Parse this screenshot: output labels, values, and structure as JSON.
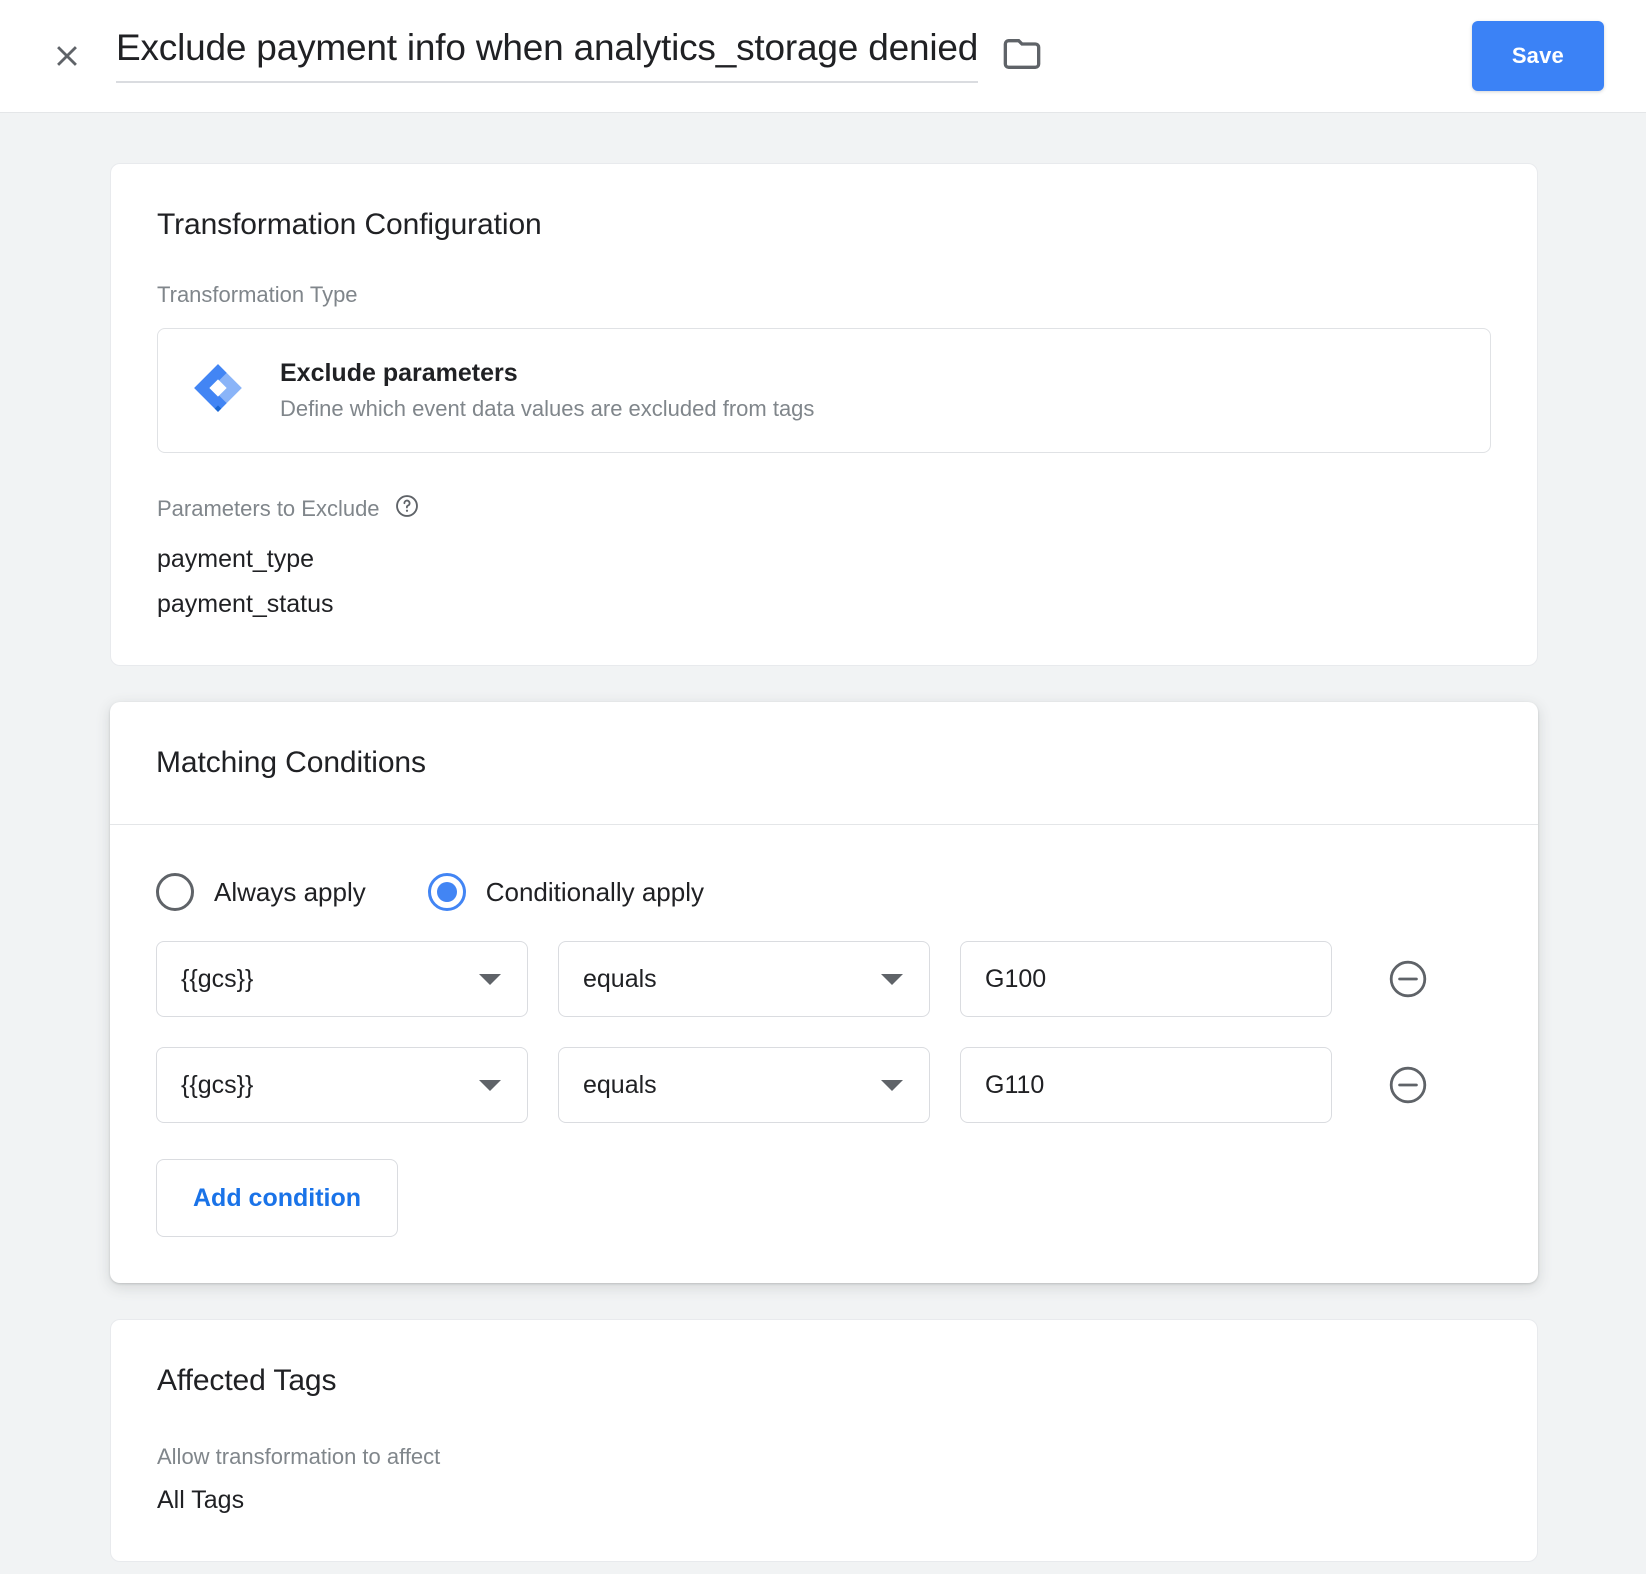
{
  "header": {
    "close_icon": "close-icon",
    "title": "Exclude payment info when analytics_storage denied",
    "folder_icon": "folder-icon",
    "save_label": "Save",
    "accent_color": "#3b82f6"
  },
  "transformation_card": {
    "title": "Transformation Configuration",
    "type_label": "Transformation Type",
    "type_icon": "gtm-diamond-icon",
    "type_name": "Exclude parameters",
    "type_description": "Define which event data values are excluded from tags",
    "params_label": "Parameters to Exclude",
    "help_icon": "help-circle-icon",
    "parameters": [
      "payment_type",
      "payment_status"
    ]
  },
  "matching_card": {
    "title": "Matching Conditions",
    "radios": [
      {
        "label": "Always apply",
        "selected": false
      },
      {
        "label": "Conditionally apply",
        "selected": true
      }
    ],
    "conditions": [
      {
        "variable": "{{gcs}}",
        "operator": "equals",
        "value": "G100",
        "value_placeholder": "",
        "insert_variable_icon": "brick-plus-icon",
        "remove_icon": "remove-circle-icon"
      },
      {
        "variable": "{{gcs}}",
        "operator": "equals",
        "value": "G110",
        "value_placeholder": "",
        "insert_variable_icon": "brick-plus-icon",
        "remove_icon": "remove-circle-icon"
      }
    ],
    "add_condition_label": "Add condition",
    "link_color": "#1a73e8"
  },
  "affected_card": {
    "title": "Affected Tags",
    "allow_label": "Allow transformation to affect",
    "allow_value": "All Tags"
  }
}
